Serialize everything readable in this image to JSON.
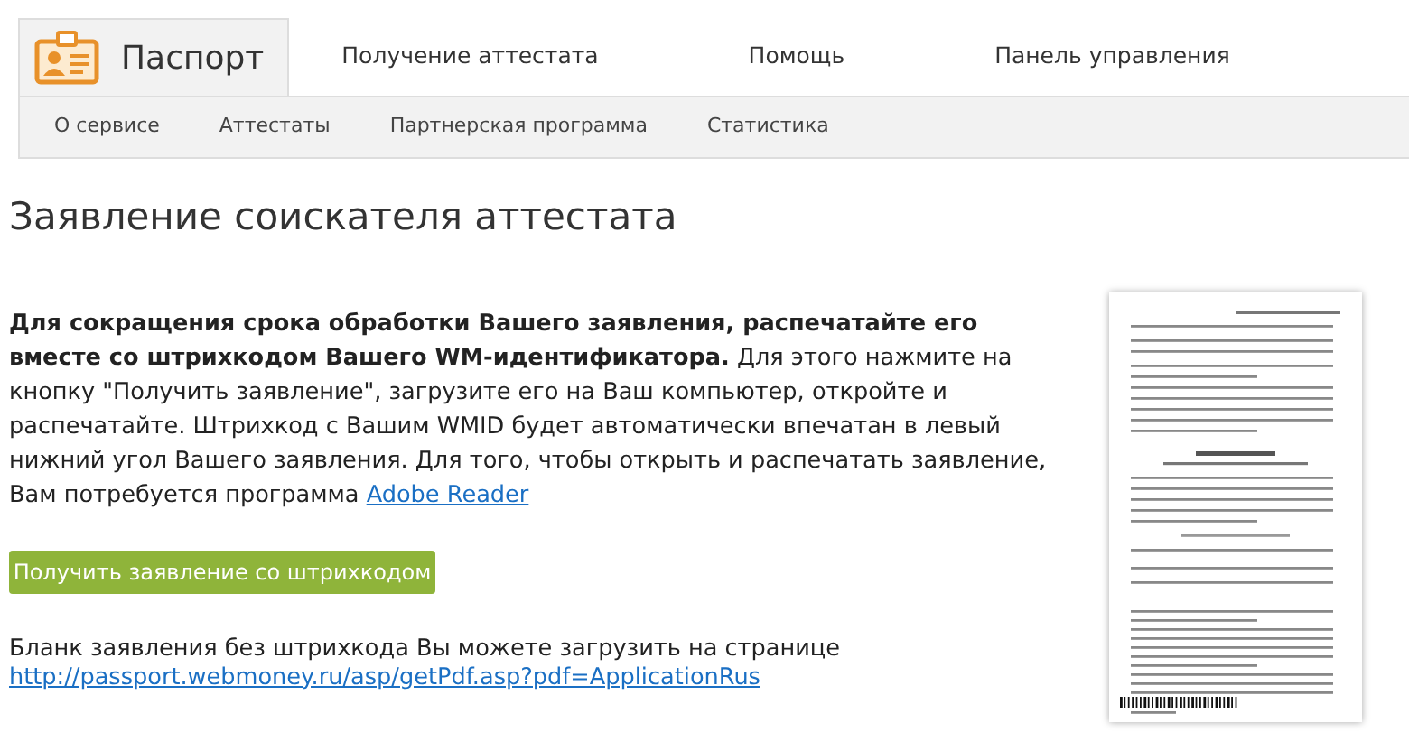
{
  "tabs": [
    {
      "label": "Паспорт",
      "kind": "brand",
      "selected": true
    },
    {
      "label": "Получение аттестата",
      "kind": "link",
      "selected": false
    },
    {
      "label": "Помощь",
      "kind": "link",
      "selected": false
    },
    {
      "label": "Панель управления",
      "kind": "link",
      "selected": false
    }
  ],
  "subnav": [
    "О сервисе",
    "Аттестаты",
    "Партнерская программа",
    "Статистика"
  ],
  "heading": "Заявление соискателя аттестата",
  "intro": {
    "text": "**Для сокращения срока обработки Вашего заявления, распечатайте его вместе со штрихкодом Вашего WM-идентификатора.** Для этого нажмите на кнопку \"Получить заявление\", загрузите его на Ваш компьютер, откройте и распечатайте. Штрихкод с Вашим WMID будет автоматически впечатан в левый нижний угол Вашего заявления. Для того, чтобы открыть и распечатать заявление, Вам потребуется программа",
    "link": "Adobe Reader"
  },
  "button": "Получить заявление со штрихкодом",
  "note": {
    "text": "Бланк заявления без штрихкода Вы можете загрузить на странице",
    "link": "http://passport.webmoney.ru/asp/getPdf.asp?pdf=ApplicationRus"
  }
}
